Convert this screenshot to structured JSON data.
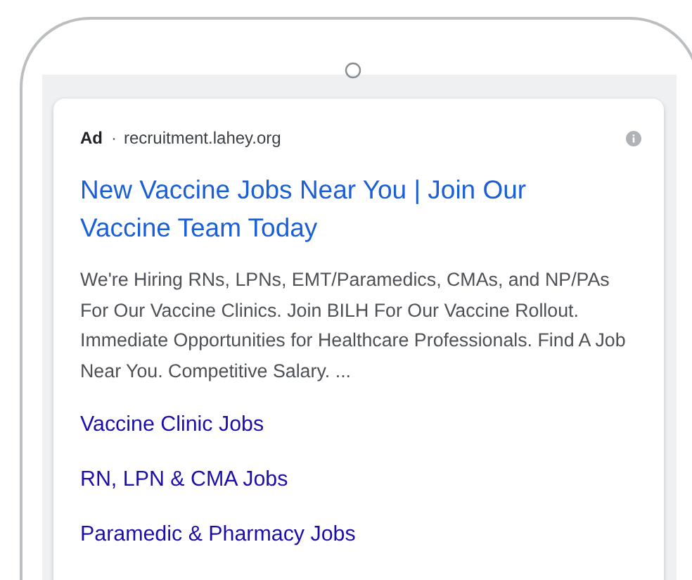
{
  "ad": {
    "label": "Ad",
    "separator": "·",
    "domain": "recruitment.lahey.org",
    "title": "New Vaccine Jobs Near You | Join Our Vaccine Team Today",
    "description": "We're Hiring RNs, LPNs, EMT/Paramedics, CMAs, and NP/PAs For Our Vaccine Clinics. Join BILH For Our Vaccine Rollout. Immediate Opportunities for Healthcare Professionals. Find A Job Near You. Competitive Salary. ...",
    "sitelinks": [
      "Vaccine Clinic Jobs",
      "RN, LPN & CMA Jobs",
      "Paramedic & Pharmacy Jobs"
    ]
  }
}
